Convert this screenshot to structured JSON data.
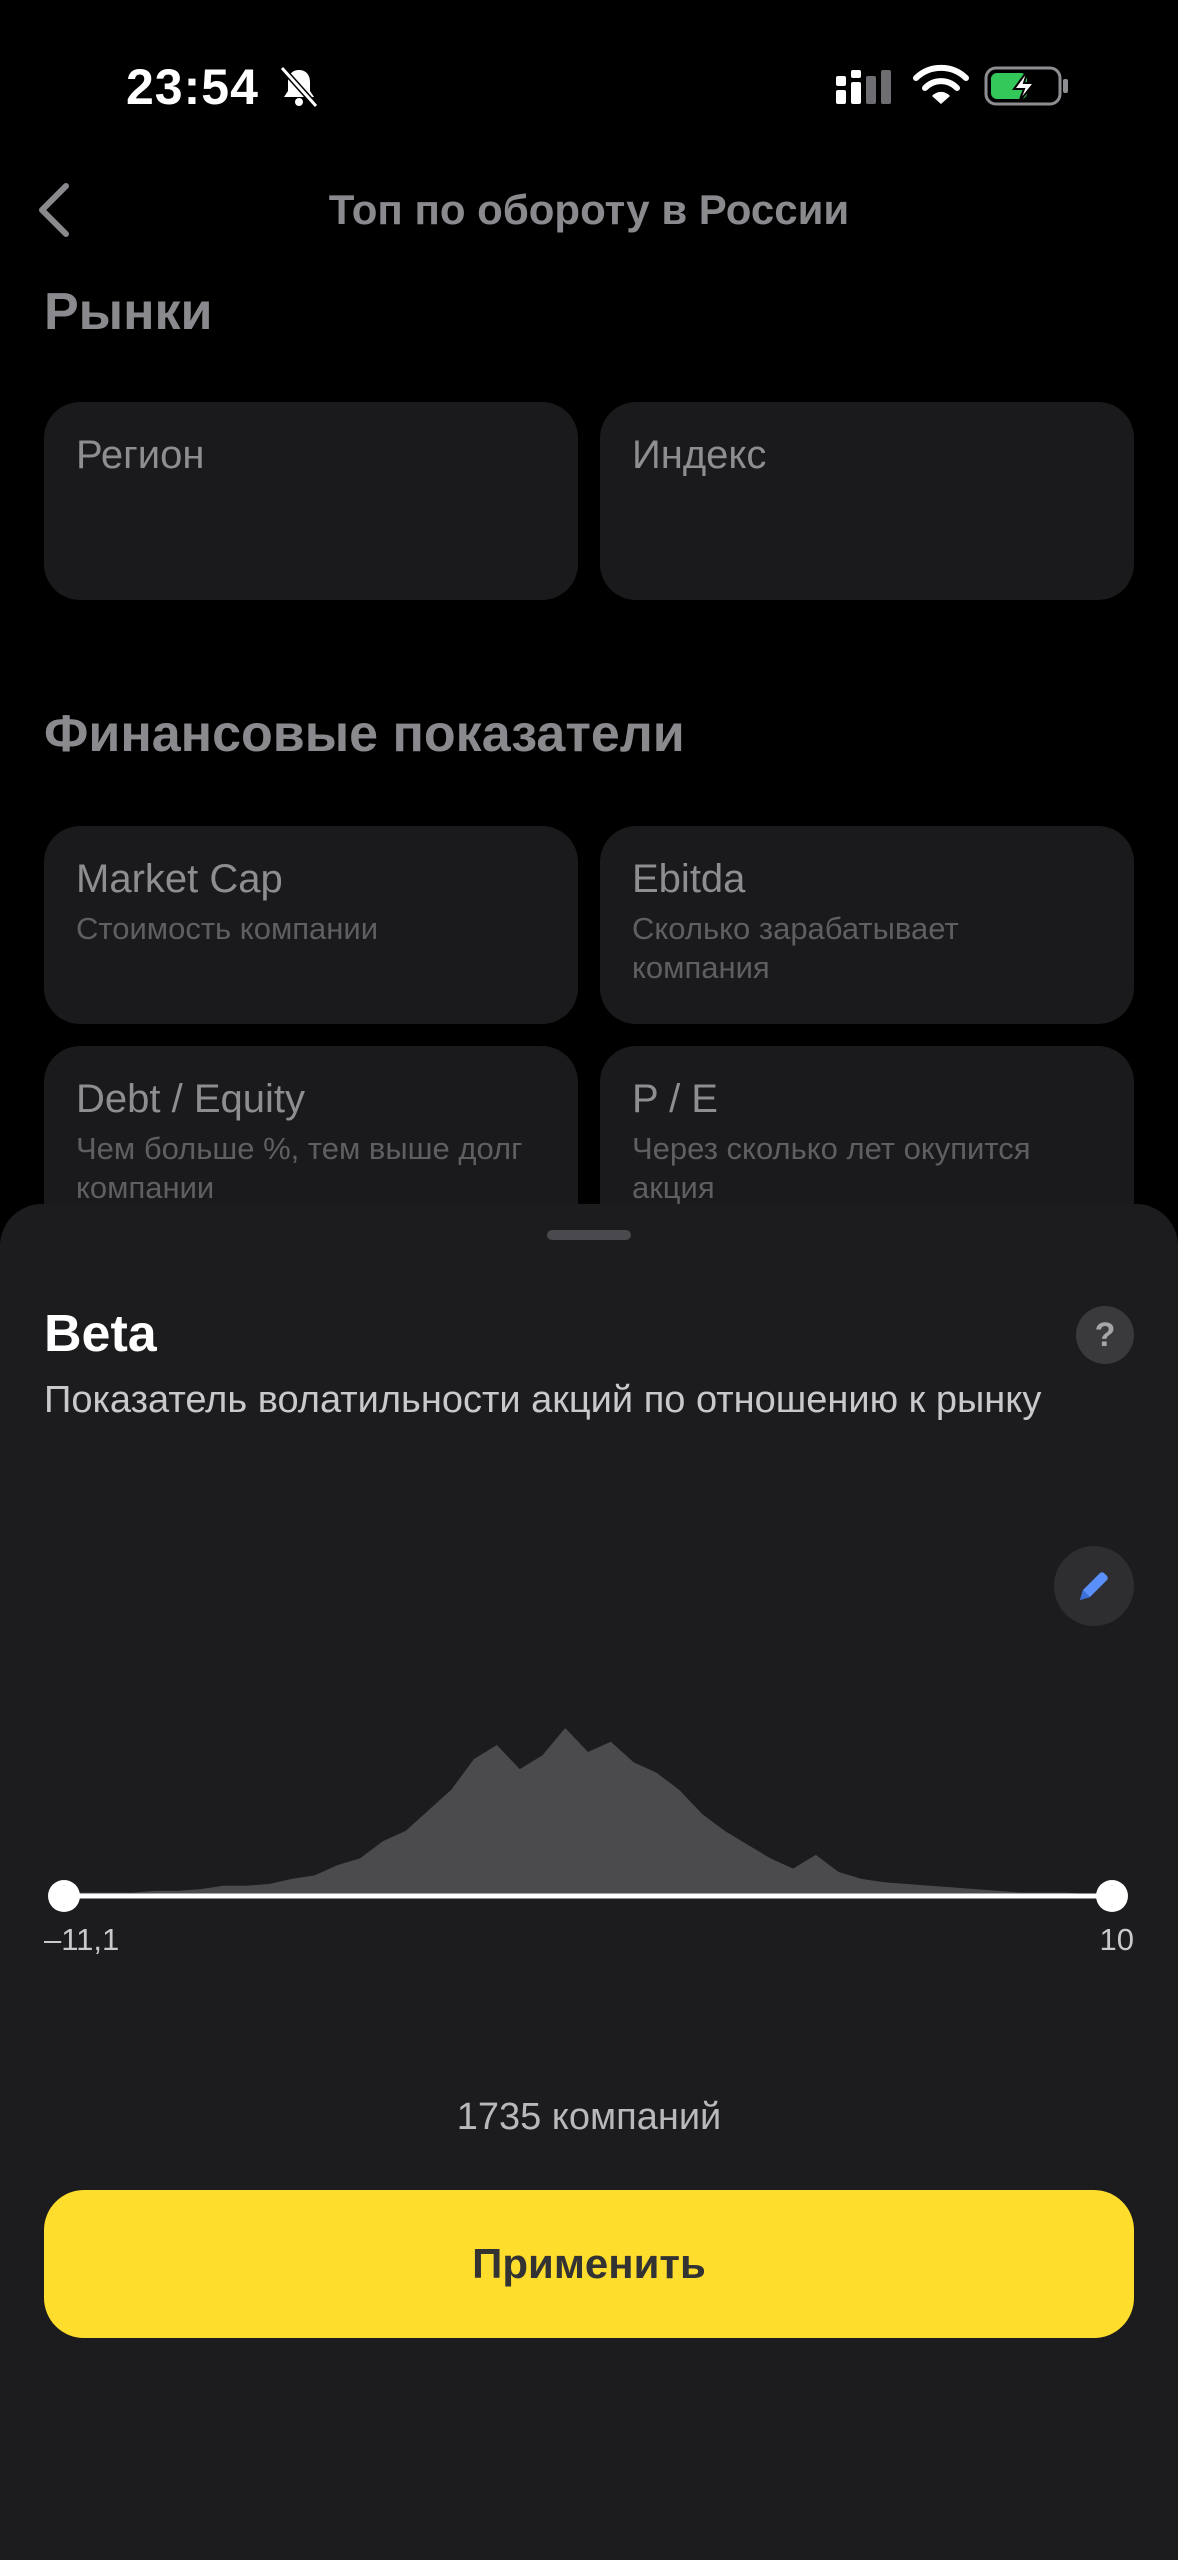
{
  "status_bar": {
    "time": "23:54",
    "icons": [
      "bell-slash-icon",
      "cellular-signal-icon",
      "wifi-icon",
      "battery-charging-icon"
    ]
  },
  "nav": {
    "title": "Топ по обороту в России",
    "back_icon": "chevron-left-icon"
  },
  "markets": {
    "title": "Рынки",
    "cards": [
      {
        "title": "Регион"
      },
      {
        "title": "Индекс"
      }
    ]
  },
  "financials": {
    "title": "Финансовые показатели",
    "cards": [
      {
        "title": "Market Cap",
        "subtitle": "Стоимость компании"
      },
      {
        "title": "Ebitda",
        "subtitle": "Сколько зарабатывает компания"
      },
      {
        "title": "Debt / Equity",
        "subtitle": "Чем больше %, тем выше долг компании"
      },
      {
        "title": "P / E",
        "subtitle": "Через сколько лет окупится акция"
      }
    ]
  },
  "sheet": {
    "title": "Beta",
    "help_label": "?",
    "description": "Показатель волатильности акций по отношению к рынку",
    "edit_icon": "pencil-icon",
    "range": {
      "min_label": "–11,1",
      "max_label": "10",
      "selected_min_fraction": 0,
      "selected_max_fraction": 1
    },
    "histogram": [
      2,
      2,
      2,
      2,
      3,
      3,
      4,
      6,
      6,
      7,
      10,
      12,
      18,
      22,
      32,
      38,
      50,
      62,
      80,
      88,
      74,
      82,
      98,
      84,
      90,
      78,
      72,
      62,
      48,
      38,
      30,
      22,
      16,
      24,
      14,
      10,
      8,
      7,
      6,
      5,
      4,
      3,
      2,
      2,
      2,
      1,
      1
    ],
    "count_text": "1735 компаний",
    "apply_label": "Применить"
  },
  "colors": {
    "accent": "#ffdd2d",
    "sheet_bg": "#1c1c1e",
    "card_bg": "#1a1a1c",
    "edit_icon": "#5b8ff9",
    "histogram_fill": "#4b4b4e"
  }
}
